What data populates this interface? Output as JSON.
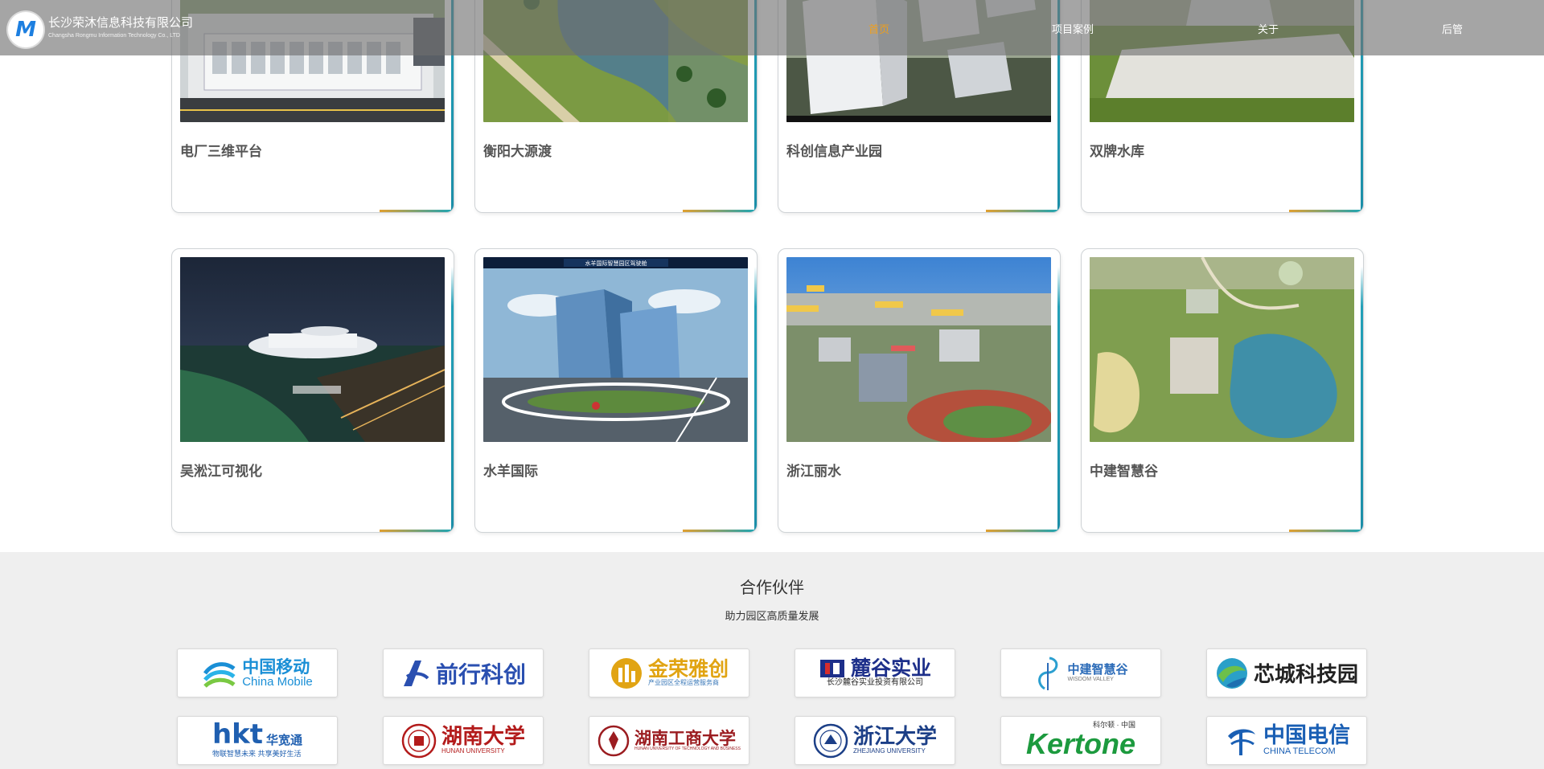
{
  "header": {
    "logo_letter": "M",
    "company_cn": "长沙荣沐信息科技有限公司",
    "company_en": "Changsha Rongmu Information Technology Co., LTD",
    "nav": [
      {
        "label": "首页",
        "active": true
      },
      {
        "label": "项目案例",
        "active": false
      },
      {
        "label": "关于",
        "active": false
      },
      {
        "label": "后管",
        "active": false
      }
    ]
  },
  "projects": [
    {
      "title": "电厂三维平台",
      "scene": "power-plant"
    },
    {
      "title": "衡阳大源渡",
      "scene": "river-aerial"
    },
    {
      "title": "科创信息产业园",
      "scene": "industrial-park"
    },
    {
      "title": "双牌水库",
      "scene": "reservoir"
    },
    {
      "title": "吴淞江可视化",
      "scene": "night-waterfront"
    },
    {
      "title": "水羊国际",
      "scene": "glass-towers",
      "overlay_title": "水羊国际智慧园区驾驶舱"
    },
    {
      "title": "浙江丽水",
      "scene": "city-aerial"
    },
    {
      "title": "中建智慧谷",
      "scene": "valley-lake"
    }
  ],
  "partners": {
    "title": "合作伙伴",
    "subtitle": "助力园区高质量发展",
    "logos": [
      {
        "name": "中国移动",
        "sub": "China Mobile",
        "color": "#1a8fd6",
        "icon": "china-mobile-logo-icon"
      },
      {
        "name": "前行科创",
        "sub": "",
        "color": "#2a4fb0",
        "icon": "qianxing-logo-icon"
      },
      {
        "name": "金荣雅创",
        "sub": "产业园区全程运营服务商",
        "color": "#e1a413",
        "icon": "jinrong-logo-icon"
      },
      {
        "name": "麓谷实业",
        "sub": "长沙麓谷实业投资有限公司",
        "color": "#1d2f8a",
        "icon": "lugu-logo-icon"
      },
      {
        "name": "中建智慧谷",
        "sub": "WISDOM VALLEY",
        "color": "#2b6bb8",
        "icon": "wisdom-valley-logo-icon"
      },
      {
        "name": "芯城科技园",
        "sub": "",
        "color": "#222222",
        "icon": "xincheng-logo-icon"
      },
      {
        "name": "华宽通",
        "sub": "物联智慧未来 共享美好生活",
        "color": "#1f5fb0",
        "icon": "hkt-logo-icon",
        "mark_text": "hkt"
      },
      {
        "name": "湖南大学",
        "sub": "HUNAN UNIVERSITY",
        "color": "#b31b1b",
        "icon": "hunan-university-seal-icon"
      },
      {
        "name": "湖南工商大学",
        "sub": "HUNAN UNIVERSITY OF TECHNOLOGY AND BUSINESS",
        "color": "#9b1c20",
        "icon": "hutb-seal-icon"
      },
      {
        "name": "浙江大学",
        "sub": "ZHEJIANG UNIVERSITY",
        "color": "#1c3f87",
        "icon": "zju-seal-icon"
      },
      {
        "name": "Kertone",
        "sub": "科尔顿 · 中国",
        "color": "#1c9a3e",
        "icon": "kertone-logo-icon"
      },
      {
        "name": "中国电信",
        "sub": "CHINA TELECOM",
        "color": "#1a5fb4",
        "icon": "china-telecom-logo-icon"
      }
    ]
  }
}
